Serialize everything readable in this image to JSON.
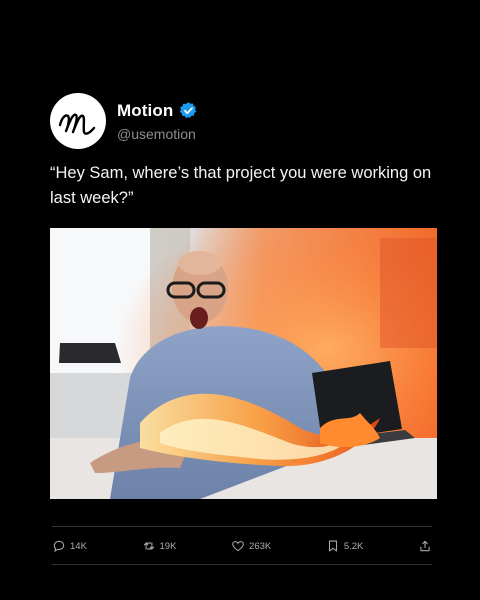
{
  "account": {
    "display_name": "Motion",
    "handle": "@usemotion",
    "verified": true,
    "avatar_icon": "motion-logo-icon",
    "verified_color": "#1d9bf0"
  },
  "tweet": {
    "text": "“Hey Sam, where’s that project you were working on last week?”",
    "media_icon": "photo-angry-man-laptop-on-fire"
  },
  "actions": {
    "reply": {
      "icon": "reply-icon",
      "count": "14K"
    },
    "retweet": {
      "icon": "retweet-icon",
      "count": "19K"
    },
    "like": {
      "icon": "heart-icon",
      "count": "263K"
    },
    "bookmark": {
      "icon": "bookmark-icon",
      "count": "5.2K"
    },
    "share": {
      "icon": "share-icon"
    }
  },
  "colors": {
    "background": "#000000",
    "text": "#ffffff",
    "muted": "#8b8f94",
    "divider": "#2f3336"
  }
}
